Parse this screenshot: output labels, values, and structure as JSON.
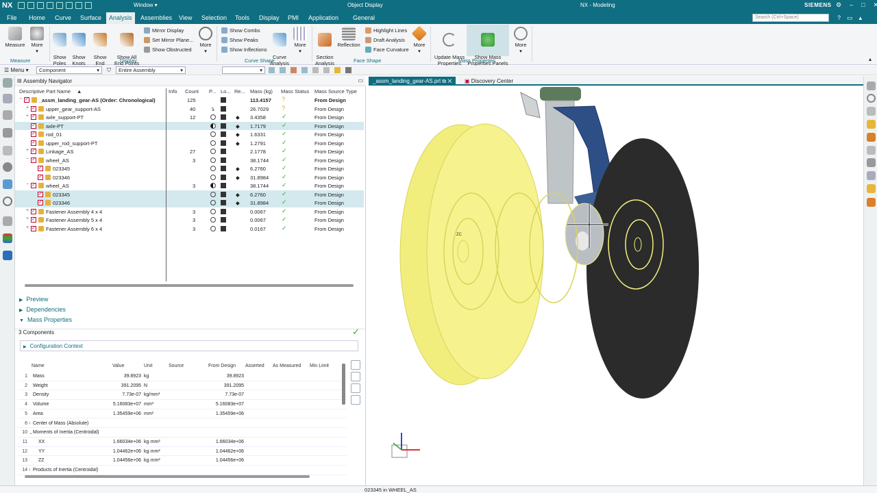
{
  "titlebar": {
    "logo": "NX",
    "window_menu": "Window",
    "context": "Object Display",
    "app": "NX - Modeling",
    "brand": "SIEMENS",
    "controls": [
      "gear-icon",
      "minimize-icon",
      "maximize-icon",
      "close-icon"
    ]
  },
  "menubar": {
    "tabs": [
      "File",
      "Home",
      "Curve",
      "Surface",
      "Analysis",
      "Assemblies",
      "View",
      "Selection",
      "Tools",
      "Display",
      "PMI",
      "Application",
      "General"
    ],
    "active": "Analysis",
    "search_placeholder": "Search (Ctrl+Space)"
  },
  "ribbon": {
    "measure": {
      "measure": "Measure",
      "more": "More",
      "group": "Measure"
    },
    "display": {
      "show_poles": "Show\nPoles",
      "show_knots": "Show\nKnots",
      "show_end_points": "Show End\nPoints",
      "show_all_end_points": "Show All\nEnd Points",
      "mirror_display": "Mirror Display",
      "set_mirror_plane": "Set Mirror Plane...",
      "show_obstructed": "Show Obstructed",
      "more": "More",
      "group": "Display"
    },
    "curve_shape": {
      "show_combs": "Show Combs",
      "show_peaks": "Show Peaks",
      "show_inflections": "Show Inflections",
      "curve_analysis": "Curve\nAnalysis",
      "more": "More",
      "group": "Curve Shape"
    },
    "face_shape": {
      "section_analysis": "Section\nAnalysis",
      "reflection": "Reflection",
      "highlight_lines": "Highlight Lines",
      "draft_analysis": "Draft Analysis",
      "face_curvature": "Face Curvature",
      "more": "More",
      "group": "Face Shape"
    },
    "mass_properties": {
      "update": "Update Mass\nProperties",
      "show_panels": "Show Mass\nProperties Panels",
      "more": "More",
      "group": "Mass Properties"
    }
  },
  "toolbar": {
    "menu": "Menu",
    "filter": "Component",
    "scope": "Entire Assembly"
  },
  "navigator": {
    "title": "Assembly Navigator",
    "columns": [
      "Descriptive Part Name",
      "Info",
      "Count",
      "P...",
      "Lo...",
      "Re...",
      "Mass (kg)",
      "Mass Status",
      "Mass Source Type"
    ],
    "rows": [
      {
        "name": "_assm_landing_gear-AS (Order: Chronological)",
        "count": "125",
        "mass": "113.4157",
        "status": "?",
        "source": "From Design",
        "bold": true
      },
      {
        "name": "upper_gear_support-AS",
        "count": "40",
        "mass": "26.7029",
        "status": "?",
        "source": "From Design"
      },
      {
        "name": "axle_support-PT",
        "count": "12",
        "mass": "3.4358",
        "status": "✓",
        "source": "From Design"
      },
      {
        "name": "axle-PT",
        "count": "",
        "mass": "1.7179",
        "status": "✓",
        "source": "From Design"
      },
      {
        "name": "rod_01",
        "count": "",
        "mass": "1.6331",
        "status": "✓",
        "source": "From Design"
      },
      {
        "name": "upper_rod_support-PT",
        "count": "",
        "mass": "1.2791",
        "status": "✓",
        "source": "From Design"
      },
      {
        "name": "Linkage_AS",
        "count": "27",
        "mass": "2.1778",
        "status": "✓",
        "source": "From Design"
      },
      {
        "name": "wheel_AS",
        "count": "3",
        "mass": "38.1744",
        "status": "✓",
        "source": "From Design"
      },
      {
        "name": "023345",
        "count": "",
        "mass": "6.2760",
        "status": "✓",
        "source": "From Design"
      },
      {
        "name": "023346",
        "count": "",
        "mass": "31.8984",
        "status": "✓",
        "source": "From Design"
      },
      {
        "name": "wheel_AS",
        "count": "3",
        "mass": "38.1744",
        "status": "✓",
        "source": "From Design"
      },
      {
        "name": "023345",
        "count": "",
        "mass": "6.2760",
        "status": "✓",
        "source": "From Design"
      },
      {
        "name": "023346",
        "count": "",
        "mass": "31.8984",
        "status": "✓",
        "source": "From Design"
      },
      {
        "name": "Fastener Assembly 4 x 4",
        "count": "3",
        "mass": "0.0067",
        "status": "✓",
        "source": "From Design"
      },
      {
        "name": "Fastener Assembly 5 x 4",
        "count": "3",
        "mass": "0.0067",
        "status": "✓",
        "source": "From Design"
      },
      {
        "name": "Fastener Assembly 6 x 4",
        "count": "3",
        "mass": "0.0167",
        "status": "✓",
        "source": "From Design"
      }
    ],
    "sections": {
      "preview": "Preview",
      "dependencies": "Dependencies",
      "mass_properties": "Mass Properties"
    },
    "components": "3 Components",
    "config_context": "Configuration Context"
  },
  "mass_table": {
    "columns": [
      "Name",
      "Value",
      "Unit",
      "Source",
      "From Design",
      "Asserted",
      "As Measured",
      "Min Limit"
    ],
    "rows": [
      {
        "n": "1",
        "name": "Mass",
        "value": "39.8923",
        "unit": "kg",
        "design": "39.8923"
      },
      {
        "n": "2",
        "name": "Weight",
        "value": "391.2095",
        "unit": "N",
        "design": "391.2095"
      },
      {
        "n": "3",
        "name": "Density",
        "value": "7.73e-07",
        "unit": "kg/mm³",
        "design": "7.73e-07"
      },
      {
        "n": "4",
        "name": "Volume",
        "value": "5.16083e+07",
        "unit": "mm³",
        "design": "5.16083e+07"
      },
      {
        "n": "5",
        "name": "Area",
        "value": "1.35459e+06",
        "unit": "mm²",
        "design": "1.35459e+06"
      },
      {
        "n": "6",
        "name": "Center of Mass (Absolute)",
        "value": "",
        "unit": "",
        "design": ""
      },
      {
        "n": "10",
        "name": "Moments of Inertia (Centroidal)",
        "value": "",
        "unit": "",
        "design": ""
      },
      {
        "n": "11",
        "name": "XX",
        "value": "1.66034e+06",
        "unit": "kg·mm²",
        "design": "1.66034e+06"
      },
      {
        "n": "12",
        "name": "YY",
        "value": "1.04462e+06",
        "unit": "kg·mm²",
        "design": "1.04462e+06"
      },
      {
        "n": "13",
        "name": "ZZ",
        "value": "1.04456e+06",
        "unit": "kg·mm²",
        "design": "1.04456e+06"
      },
      {
        "n": "14",
        "name": "Products of Inertia (Centroidal)",
        "value": "",
        "unit": "",
        "design": ""
      }
    ]
  },
  "graphics": {
    "tab_active": "_assm_landing_gear-AS.prt",
    "tab_other": "Discovery Center",
    "triad_label": "ZC"
  },
  "status": "023345 in WHEEL_AS",
  "colors": {
    "teal": "#0f6e81",
    "wireframe": "#f4f07a",
    "tire": "#2c2c2c",
    "strut": "#2c4f8a"
  }
}
